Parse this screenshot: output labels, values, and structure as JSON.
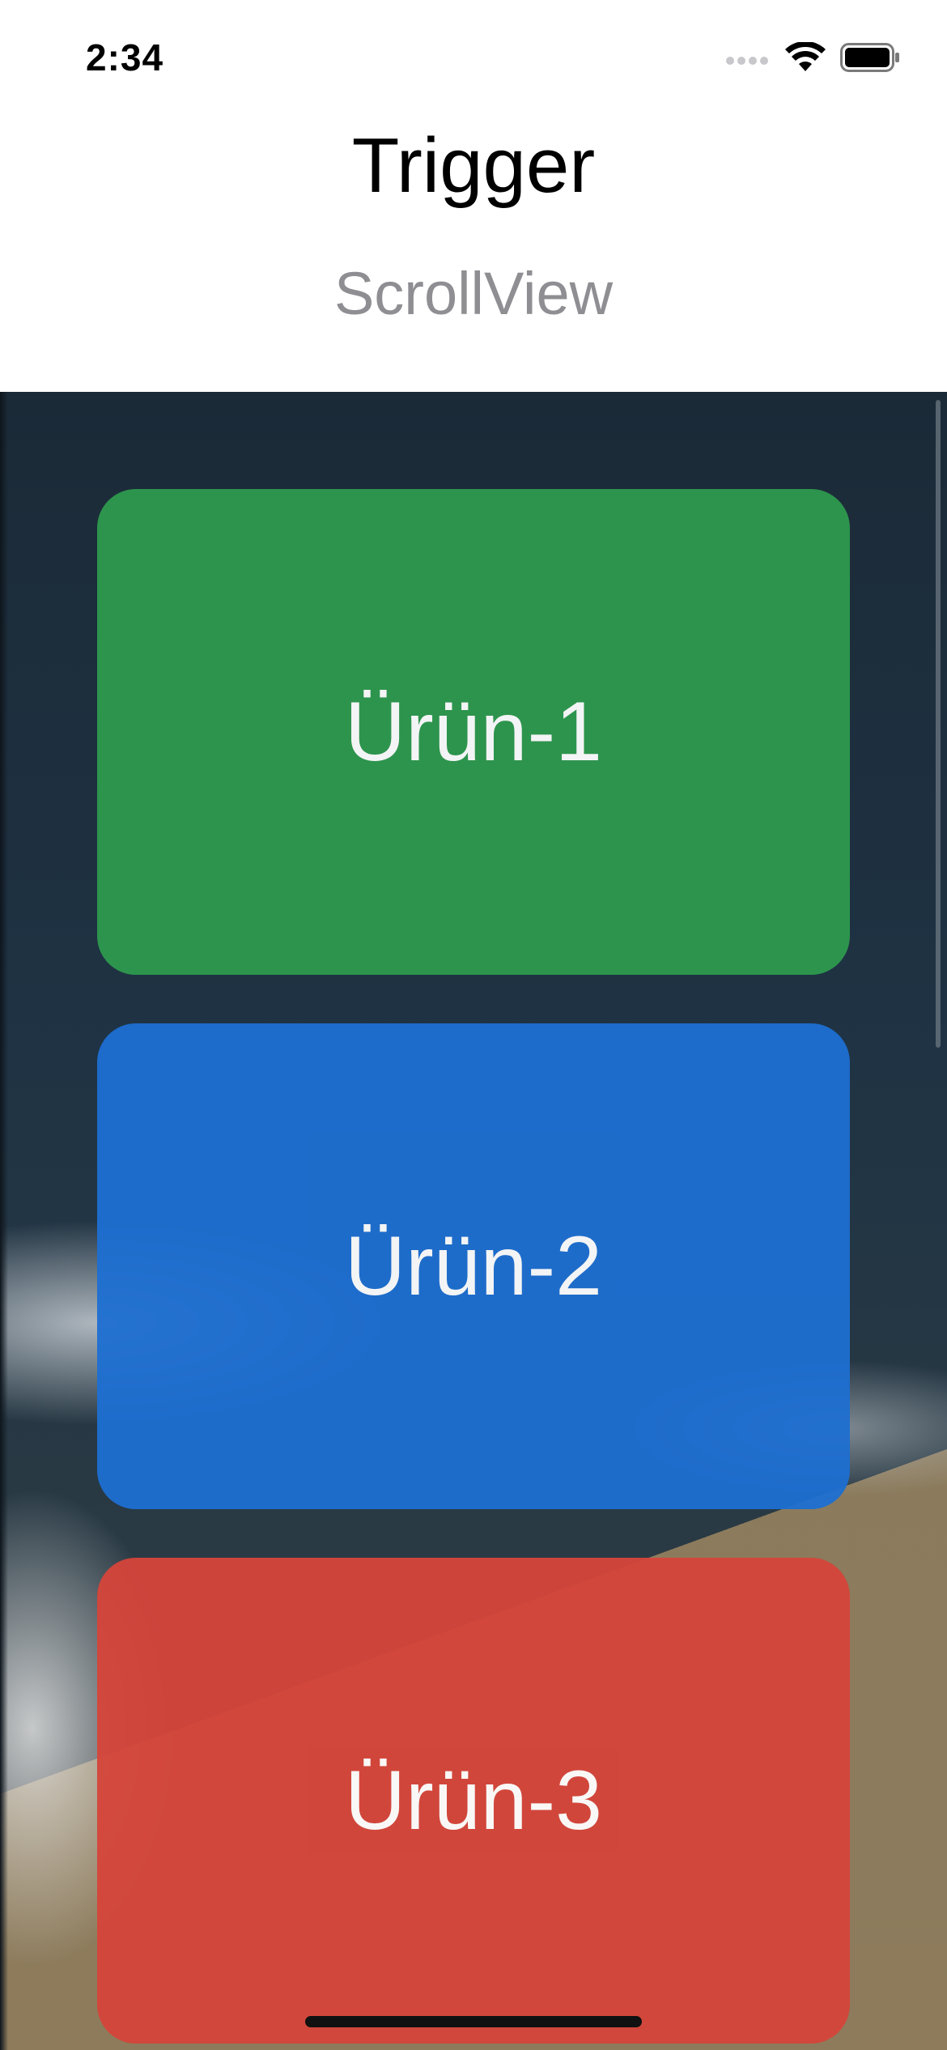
{
  "status_bar": {
    "time": "2:34",
    "icons": [
      "cellular-signal-icon",
      "wifi-icon",
      "battery-icon"
    ]
  },
  "header": {
    "title": "Trigger",
    "subtitle": "ScrollView"
  },
  "scroll_view": {
    "cards": [
      {
        "label": "Ürün-1",
        "color": "#2E9A4E"
      },
      {
        "label": "Ürün-2",
        "color": "#1E6FD2"
      },
      {
        "label": "Ürün-3",
        "color": "#D5443A"
      }
    ]
  },
  "colors": {
    "subtitle_gray": "#8E8E93",
    "background_dark": "#1F3344"
  }
}
